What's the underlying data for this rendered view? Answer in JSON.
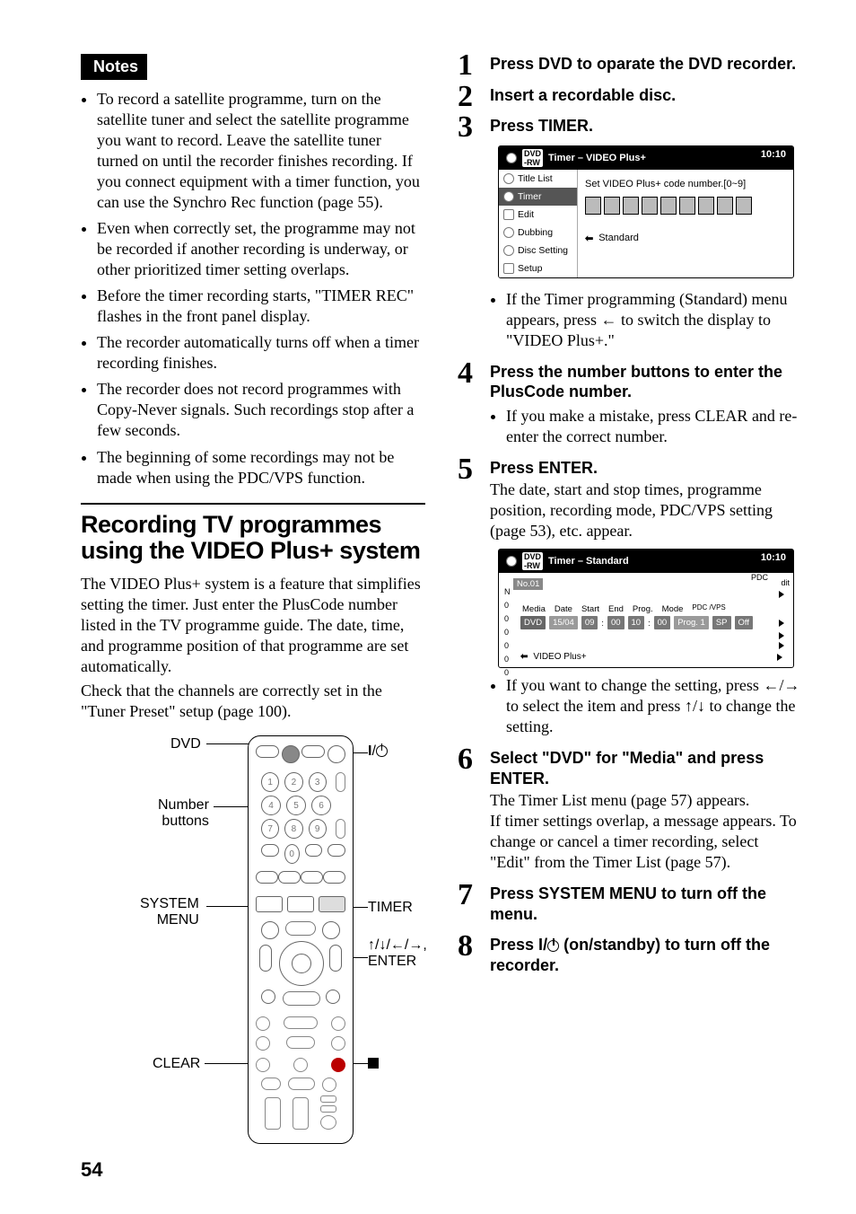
{
  "left": {
    "notes_label": "Notes",
    "bullets": [
      "To record a satellite programme, turn on the satellite tuner and select the satellite programme you want to record. Leave the satellite tuner turned on until the recorder finishes recording. If you connect equipment with a timer function, you can use the Synchro Rec function (page 55).",
      "Even when correctly set, the programme may not be recorded if another recording is underway, or other prioritized timer setting overlaps.",
      "Before the timer recording starts, \"TIMER REC\" flashes in the front panel display.",
      "The recorder automatically turns off when a timer recording finishes.",
      "The recorder does not record programmes with Copy-Never signals. Such recordings stop after a few seconds.",
      "The beginning of some recordings may not be made when using the PDC/VPS function."
    ],
    "section_title": "Recording TV programmes using the VIDEO Plus+ system",
    "para1": "The VIDEO Plus+ system is a feature that simplifies setting the timer. Just enter the PlusCode number listed in the TV programme guide. The date, time, and programme position of that programme are set automatically.",
    "para2": "Check that the channels are correctly set in the \"Tuner Preset\" setup (page 100).",
    "remote_labels": {
      "dvd": "DVD",
      "number": "Number\nbuttons",
      "system": "SYSTEM\nMENU",
      "clear": "CLEAR",
      "power": "",
      "timer": "TIMER",
      "arrows": ",\nENTER",
      "stop": ""
    }
  },
  "right": {
    "steps": [
      {
        "head": "Press DVD to oparate the DVD recorder."
      },
      {
        "head": "Insert a recordable disc."
      },
      {
        "head": "Press TIMER.",
        "sub": [
          "If the Timer programming (Standard) menu appears, press ← to switch the display to \"VIDEO Plus+.\""
        ]
      },
      {
        "head": "Press the number buttons to enter the PlusCode number.",
        "sub": [
          "If you make a mistake, press CLEAR and re-enter the correct number."
        ]
      },
      {
        "head": "Press ENTER.",
        "body": "The date, start and stop times, programme position, recording mode, PDC/VPS setting (page 53), etc. appear.",
        "sub": [
          "If you want to change the setting, press ←/→ to select the item and press ↑/↓ to change the setting."
        ]
      },
      {
        "head": "Select \"DVD\" for \"Media\" and press ENTER.",
        "body": "The Timer List menu (page 57) appears.\nIf timer settings overlap, a message appears. To change or cancel a timer recording, select \"Edit\" from the Timer List (page 57)."
      },
      {
        "head": "Press SYSTEM MENU to turn off the menu."
      },
      {
        "head_html": true,
        "head": "Press I/⏻ (on/standby) to turn off the recorder."
      }
    ],
    "osd1": {
      "title": "Timer – VIDEO Plus+",
      "clock": "10:10",
      "side": [
        "Title List",
        "Timer",
        "Edit",
        "Dubbing",
        "Disc Setting",
        "Setup"
      ],
      "side_active": 1,
      "msg": "Set VIDEO Plus+ code number.[0~9]",
      "return": "Standard"
    },
    "osd2": {
      "title": "Timer – Standard",
      "clock": "10:10",
      "no": "No.01",
      "pdc": "PDC",
      "dit": "dit",
      "left_nums": [
        "N",
        "0",
        "0",
        "0",
        "0",
        "0",
        "0"
      ],
      "headers": [
        "Media",
        "Date",
        "Start",
        "End",
        "Prog.",
        "Mode",
        "PDC\n/VPS"
      ],
      "row": [
        "DVD",
        "15/04",
        "09",
        "00",
        "10",
        "00",
        "Prog. 1",
        "SP",
        "Off"
      ],
      "return": "VIDEO Plus+"
    }
  },
  "page_number": "54"
}
